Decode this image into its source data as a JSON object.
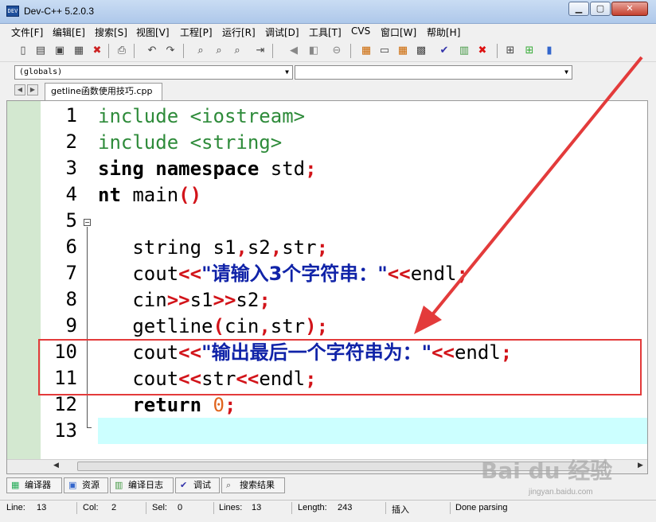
{
  "window": {
    "title": "Dev-C++ 5.2.0.3",
    "app_icon_text": "DEV"
  },
  "menu": [
    {
      "label": "文件[F]"
    },
    {
      "label": "编辑[E]"
    },
    {
      "label": "搜索[S]"
    },
    {
      "label": "视图[V]"
    },
    {
      "label": "工程[P]"
    },
    {
      "label": "运行[R]"
    },
    {
      "label": "调试[D]"
    },
    {
      "label": "工具[T]"
    },
    {
      "label": "CVS"
    },
    {
      "label": "窗口[W]"
    },
    {
      "label": "帮助[H]"
    }
  ],
  "toolbar": {
    "icons": [
      "new-file-icon",
      "open-icon",
      "save-icon",
      "save-all-icon",
      "close-icon",
      "print-icon",
      "undo-icon",
      "redo-icon",
      "find-icon",
      "find-next-icon",
      "replace-icon",
      "goto-icon",
      "indent-icon",
      "unindent-icon",
      "toggle-comment-icon",
      "compile-icon",
      "run-icon",
      "compile-run-icon",
      "rebuild-icon",
      "check-syntax-icon",
      "chart-icon",
      "stop-icon",
      "new-project-icon",
      "add-file-icon",
      "remove-file-icon"
    ]
  },
  "class_combo": {
    "value": "(globals)"
  },
  "member_combo": {
    "value": ""
  },
  "file_tab": {
    "label": "getline函数使用技巧.cpp"
  },
  "editor": {
    "line_numbers": [
      "1",
      "2",
      "3",
      "4",
      "5",
      "6",
      "7",
      "8",
      "9",
      "10",
      "11",
      "12",
      "13"
    ],
    "lines": {
      "l1a": "include <iostream>",
      "l2a": "include <string>",
      "l3a": "sing namespace",
      "l3b": " std",
      "l3c": ";",
      "l4a": "nt",
      "l4b": " main",
      "l4c": "()",
      "l6a": "   string s1",
      "l6b": ",",
      "l6c": "s2",
      "l6d": ",",
      "l6e": "str",
      "l6f": ";",
      "l7a": "   cout",
      "l7b": "<<",
      "l7c": "\"请输入3个字符串：\"",
      "l7d": "<<",
      "l7e": "endl",
      "l7f": ";",
      "l8a": "   cin",
      "l8b": ">>",
      "l8c": "s1",
      "l8d": ">>",
      "l8e": "s2",
      "l8f": ";",
      "l9a": "   getline",
      "l9b": "(",
      "l9c": "cin",
      "l9d": ",",
      "l9e": "str",
      "l9f": ")",
      "l9g": ";",
      "l10a": "   cout",
      "l10b": "<<",
      "l10c": "\"输出最后一个字符串为：\"",
      "l10d": "<<",
      "l10e": "endl",
      "l10f": ";",
      "l11a": "   cout",
      "l11b": "<<",
      "l11c": "str",
      "l11d": "<<",
      "l11e": "endl",
      "l11f": ";",
      "l12a": "   return",
      "l12b": " 0",
      "l12c": ";"
    }
  },
  "bottom_tabs": [
    {
      "label": "编译器",
      "icon": "compiler-icon"
    },
    {
      "label": "资源",
      "icon": "resources-icon"
    },
    {
      "label": "编译日志",
      "icon": "compile-log-icon"
    },
    {
      "label": "调试",
      "icon": "debug-icon"
    },
    {
      "label": "搜索结果",
      "icon": "search-results-icon"
    }
  ],
  "status": {
    "line_label": "Line:",
    "line_value": "13",
    "col_label": "Col:",
    "col_value": "2",
    "sel_label": "Sel:",
    "sel_value": "0",
    "lines_label": "Lines:",
    "lines_value": "13",
    "length_label": "Length:",
    "length_value": "243",
    "insert": "插入",
    "parsing": "Done parsing"
  },
  "watermark": {
    "brand": "Bai du 经验",
    "url": "jingyan.baidu.com"
  },
  "colors": {
    "keyword_green": "#2e8b3a",
    "operator_red": "#d2141a",
    "string_blue": "#1023a8",
    "current_line": "#ccffff",
    "gutter_green": "#d3e8d0",
    "annotation_red": "#e33b3b"
  }
}
